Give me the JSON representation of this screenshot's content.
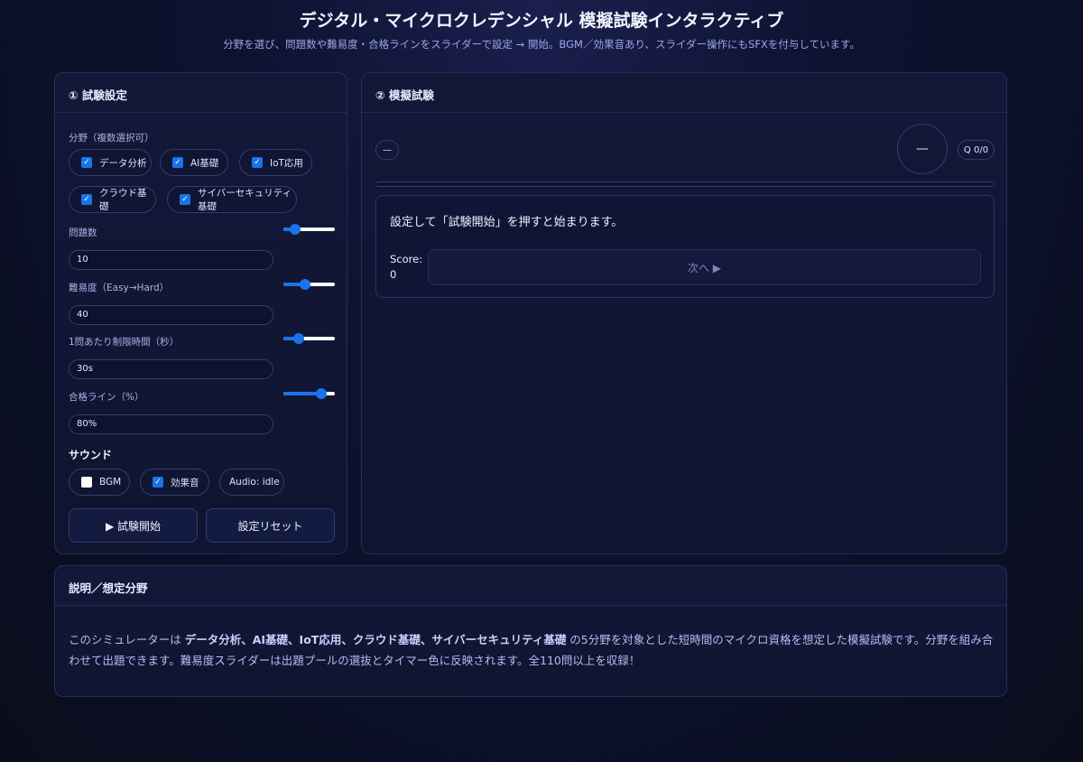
{
  "header": {
    "title": "デジタル・マイクロクレデンシャル 模擬試験インタラクティブ",
    "subtitle": "分野を選び、問題数や難易度・合格ラインをスライダーで設定 → 開始。BGM／効果音あり、スライダー操作にもSFXを付与しています。"
  },
  "settings": {
    "panel_title": "① 試験設定",
    "fields_label": "分野（複数選択可）",
    "fields": [
      {
        "label": "データ分析",
        "checked": true
      },
      {
        "label": "AI基礎",
        "checked": true
      },
      {
        "label": "IoT応用",
        "checked": true
      },
      {
        "label": "クラウド基礎",
        "checked": true
      },
      {
        "label": "サイバーセキュリティ基礎",
        "checked": true
      }
    ],
    "question_count": {
      "label": "問題数",
      "value": "10",
      "level": 0.15
    },
    "difficulty": {
      "label": "難易度（Easy→Hard）",
      "value": "40",
      "level": 0.4
    },
    "time_limit": {
      "label": "1問あたり制限時間（秒）",
      "value": "30s",
      "level": 0.25
    },
    "pass_line": {
      "label": "合格ライン（%）",
      "value": "80%",
      "level": 0.8
    },
    "sound_title": "サウンド",
    "bgm": {
      "label": "BGM",
      "checked": false
    },
    "sfx": {
      "label": "効果音",
      "checked": true
    },
    "audio_status": "Audio: idle",
    "start_button": "▶ 試験開始",
    "reset_button": "設定リセット"
  },
  "exam": {
    "panel_title": "② 模擬試験",
    "status_pill": "—",
    "timer": "—",
    "question_counter": "Q 0/0",
    "progress": 0,
    "prompt": "設定して「試験開始」を押すと始まります。",
    "score_label": "Score:",
    "score_value": "0",
    "next_button": "次へ ▶"
  },
  "about": {
    "panel_title": "説明／想定分野",
    "pre": "このシミュレーターは ",
    "fields_bold": "データ分析、AI基礎、IoT応用、クラウド基礎、サイバーセキュリティ基礎",
    "post": " の5分野を対象とした短時間のマイクロ資格を想定した模擬試験です。分野を組み合わせて出題できます。難易度スライダーは出題プールの選抜とタイマー色に反映されます。全110問以上を収録！"
  },
  "colors": {
    "accent": "#1a73e8",
    "panel_bg": "#121838",
    "border": "#252d5c",
    "text_muted": "#9aa6e6"
  }
}
